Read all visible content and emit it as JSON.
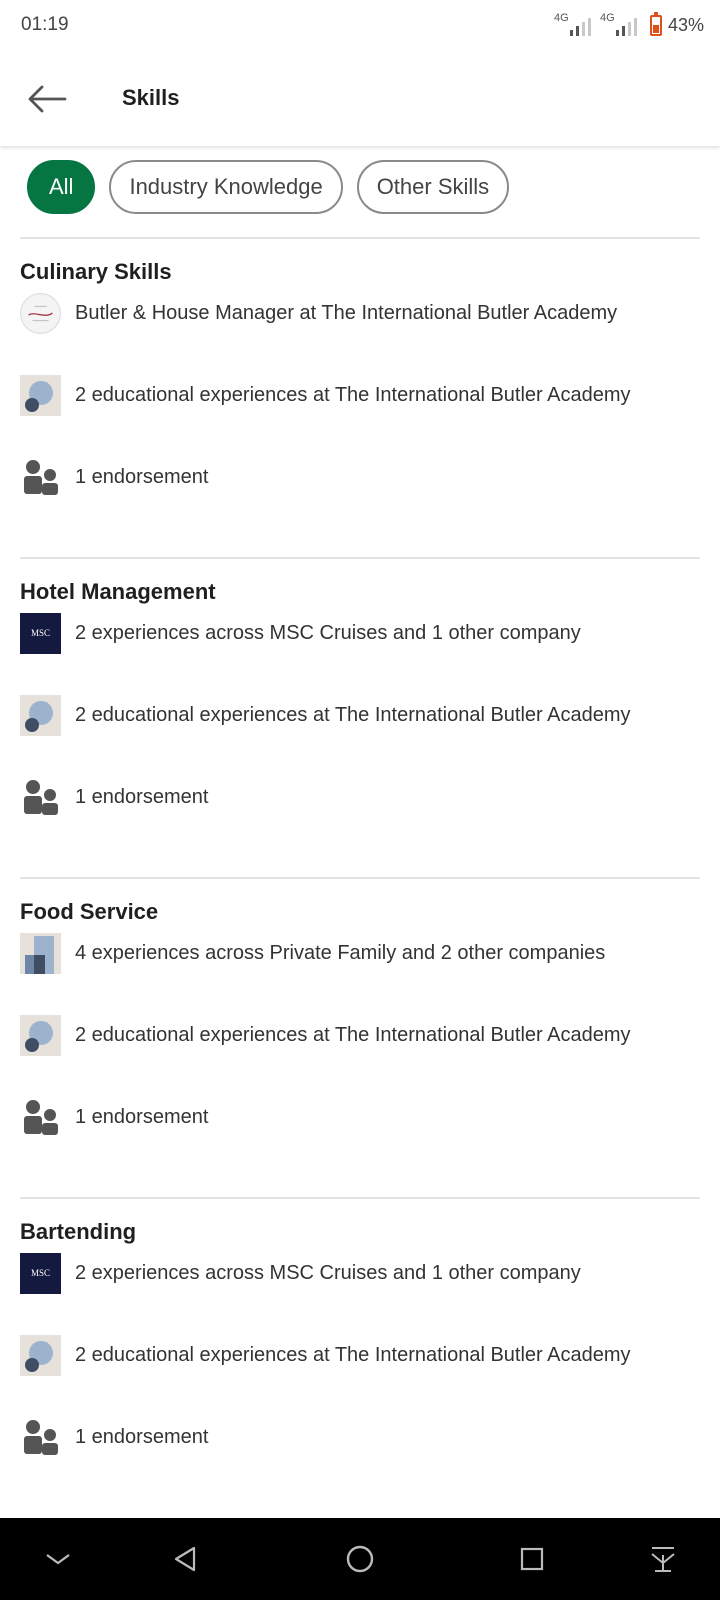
{
  "status": {
    "time": "01:19",
    "sim1": "4G",
    "sim2": "4G",
    "battery": "43%",
    "battery_level": 0.43
  },
  "header": {
    "title": "Skills",
    "back_icon": "arrow-left-icon"
  },
  "filters": [
    {
      "label": "All",
      "active": true
    },
    {
      "label": "Industry Knowledge",
      "active": false
    },
    {
      "label": "Other Skills",
      "active": false
    }
  ],
  "sections": [
    {
      "title": "Culinary Skills",
      "rows": [
        {
          "icon": "butler-academy-logo",
          "text": "Butler & House Manager at The International Butler Academy"
        },
        {
          "icon": "education-icon",
          "text": "2 educational experiences at The International Butler Academy"
        },
        {
          "icon": "endorsement-icon",
          "text": "1 endorsement"
        }
      ]
    },
    {
      "title": "Hotel Management",
      "rows": [
        {
          "icon": "msc-cruises-logo",
          "text": "2 experiences across MSC Cruises and 1 other company"
        },
        {
          "icon": "education-icon",
          "text": "2 educational experiences at The International Butler Academy"
        },
        {
          "icon": "endorsement-icon",
          "text": "1 endorsement"
        }
      ]
    },
    {
      "title": "Food Service",
      "rows": [
        {
          "icon": "company-icon",
          "text": "4 experiences across Private Family and 2 other companies"
        },
        {
          "icon": "education-icon",
          "text": "2 educational experiences at The International Butler Academy"
        },
        {
          "icon": "endorsement-icon",
          "text": "1 endorsement"
        }
      ]
    },
    {
      "title": "Bartending",
      "rows": [
        {
          "icon": "msc-cruises-logo",
          "text": "2 experiences across MSC Cruises and 1 other company"
        },
        {
          "icon": "education-icon",
          "text": "2 educational experiences at The International Butler Academy"
        },
        {
          "icon": "endorsement-icon",
          "text": "1 endorsement"
        }
      ]
    }
  ],
  "logos": {
    "msc": "MSC"
  },
  "navbar": {
    "buttons": [
      "chevron-down-icon",
      "back-triangle-icon",
      "home-circle-icon",
      "recents-square-icon",
      "download-arrow-icon"
    ]
  },
  "colors": {
    "accent": "#057642",
    "msc_navy": "#14193f",
    "battery": "#e0501b"
  }
}
